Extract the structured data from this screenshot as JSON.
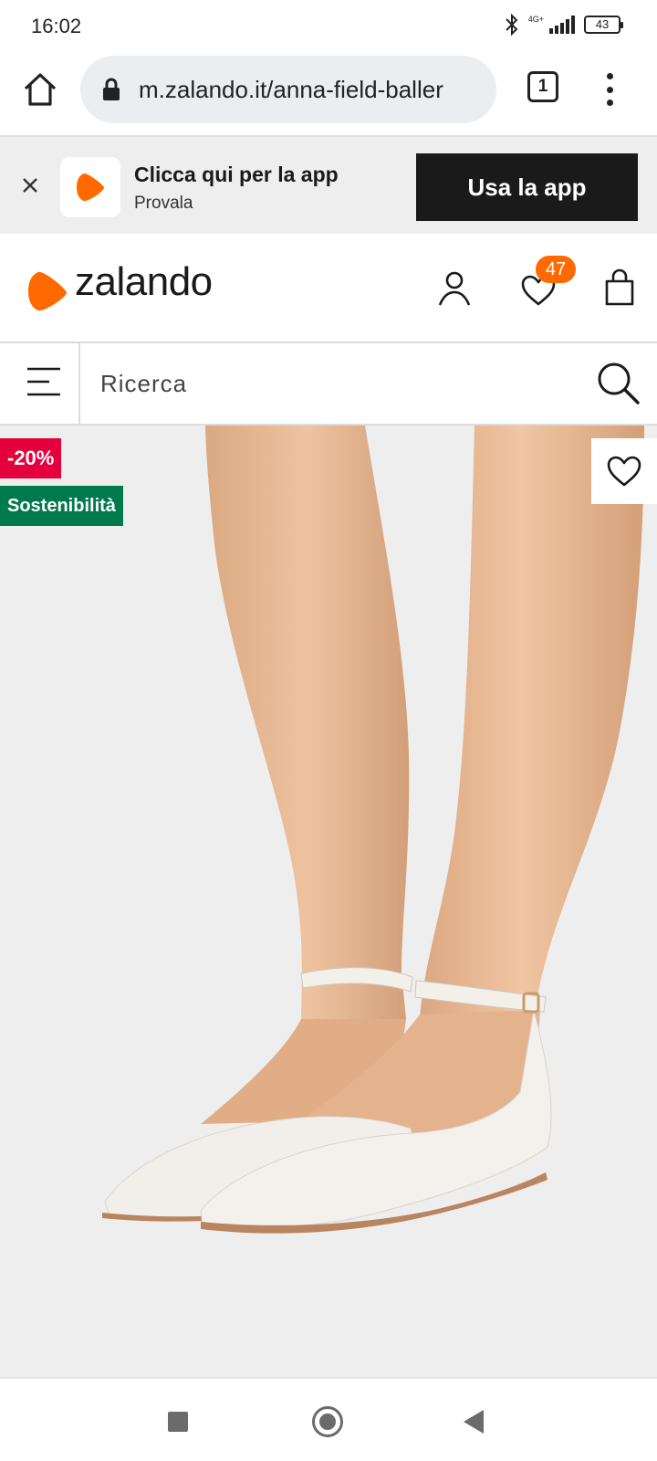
{
  "status_bar": {
    "time": "16:02",
    "network": "4G+",
    "battery": "43",
    "icons": [
      "bluetooth-icon",
      "signal-icon",
      "battery-icon"
    ]
  },
  "browser": {
    "url": "m.zalando.it/anna-field-baller",
    "tab_count": "1",
    "icons": [
      "home-icon",
      "lock-icon",
      "tabs-icon",
      "overflow-menu-icon"
    ]
  },
  "app_banner": {
    "title": "Clicca qui per la app",
    "subtitle": "Provala",
    "cta": "Usa la app",
    "icons": [
      "close-icon",
      "zalando-app-logo"
    ]
  },
  "header": {
    "logo_text": "zalando",
    "wishlist_count": "47",
    "icons": [
      "account-icon",
      "wishlist-heart-icon",
      "shopping-bag-icon"
    ]
  },
  "search": {
    "placeholder": "Ricerca",
    "icons": [
      "hamburger-menu-icon",
      "search-icon"
    ]
  },
  "product": {
    "discount_badge": "-20%",
    "sustainability_badge": "Sostenibilità",
    "icons": [
      "heart-icon"
    ]
  },
  "colors": {
    "brand_orange": "#ff6900",
    "discount_red": "#e3003c",
    "sustainability_green": "#007a4d",
    "cta_black": "#1a1a1a",
    "image_background": "#eeeeee"
  }
}
